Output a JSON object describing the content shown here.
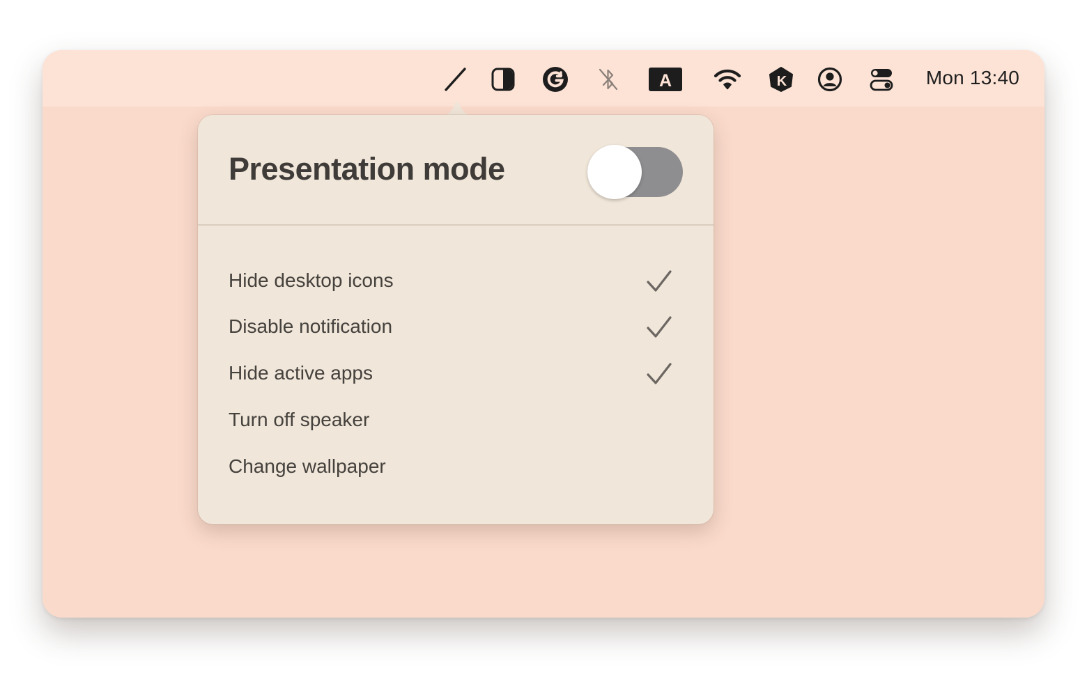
{
  "menubar": {
    "icons": [
      {
        "name": "presentation-pen-icon"
      },
      {
        "name": "contrast-icon"
      },
      {
        "name": "grammarly-icon"
      },
      {
        "name": "bluetooth-off-icon"
      },
      {
        "name": "keyboard-input-icon",
        "text": "A"
      },
      {
        "name": "wifi-icon"
      },
      {
        "name": "klack-icon",
        "text": "K"
      },
      {
        "name": "user-account-icon"
      },
      {
        "name": "control-center-icon"
      }
    ],
    "clock": "Mon 13:40"
  },
  "popover": {
    "title": "Presentation mode",
    "toggle_on": false,
    "options": [
      {
        "label": "Hide desktop icons",
        "checked": true
      },
      {
        "label": "Disable notification",
        "checked": true
      },
      {
        "label": "Hide active apps",
        "checked": true
      },
      {
        "label": "Turn off speaker",
        "checked": false
      },
      {
        "label": "Change wallpaper",
        "checked": false
      }
    ]
  },
  "colors": {
    "desktop": "#fadacb",
    "menubar": "#fde3d6",
    "popover": "#f0e6d9",
    "toggle_off": "#8e8d8f",
    "check": "#6b6661"
  }
}
